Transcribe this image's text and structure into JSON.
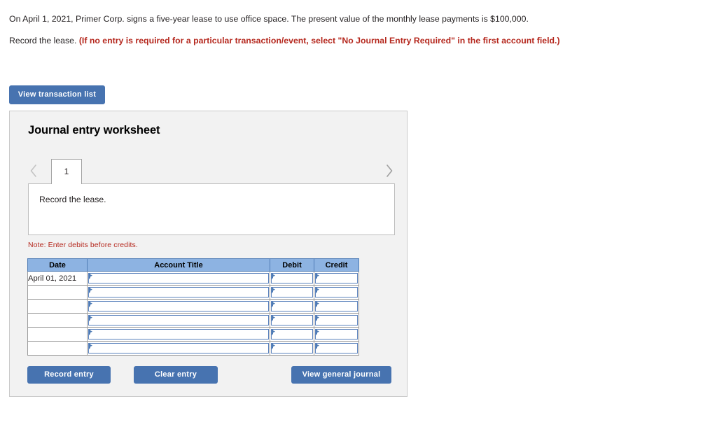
{
  "problem": {
    "paragraph1": "On April 1, 2021, Primer Corp. signs a five-year lease to use office space. The present value of the monthly lease payments is $100,000.",
    "paragraph2_plain": "Record the lease. ",
    "paragraph2_red": "(If no entry is required for a particular transaction/event, select \"No Journal Entry Required\" in the first account field.)"
  },
  "toolbar": {
    "view_transaction_list_label": "View transaction list"
  },
  "worksheet": {
    "title": "Journal entry worksheet",
    "pager": {
      "prev_icon": "chevron-left-icon",
      "next_icon": "chevron-right-icon",
      "current_tab": "1"
    },
    "description": "Record the lease.",
    "note": "Note: Enter debits before credits.",
    "table": {
      "columns": [
        "Date",
        "Account Title",
        "Debit",
        "Credit"
      ],
      "rows": [
        {
          "date": "April 01, 2021",
          "account": "",
          "debit": "",
          "credit": ""
        },
        {
          "date": "",
          "account": "",
          "debit": "",
          "credit": ""
        },
        {
          "date": "",
          "account": "",
          "debit": "",
          "credit": ""
        },
        {
          "date": "",
          "account": "",
          "debit": "",
          "credit": ""
        },
        {
          "date": "",
          "account": "",
          "debit": "",
          "credit": ""
        },
        {
          "date": "",
          "account": "",
          "debit": "",
          "credit": ""
        }
      ]
    },
    "actions": {
      "record_entry_label": "Record entry",
      "clear_entry_label": "Clear entry",
      "view_general_journal_label": "View general journal"
    }
  },
  "colors": {
    "button_blue": "#4773b0",
    "header_blue": "#8db3e2",
    "alert_red": "#b5281e",
    "panel_bg": "#f2f2f2",
    "input_border_blue": "#5b82bd"
  }
}
